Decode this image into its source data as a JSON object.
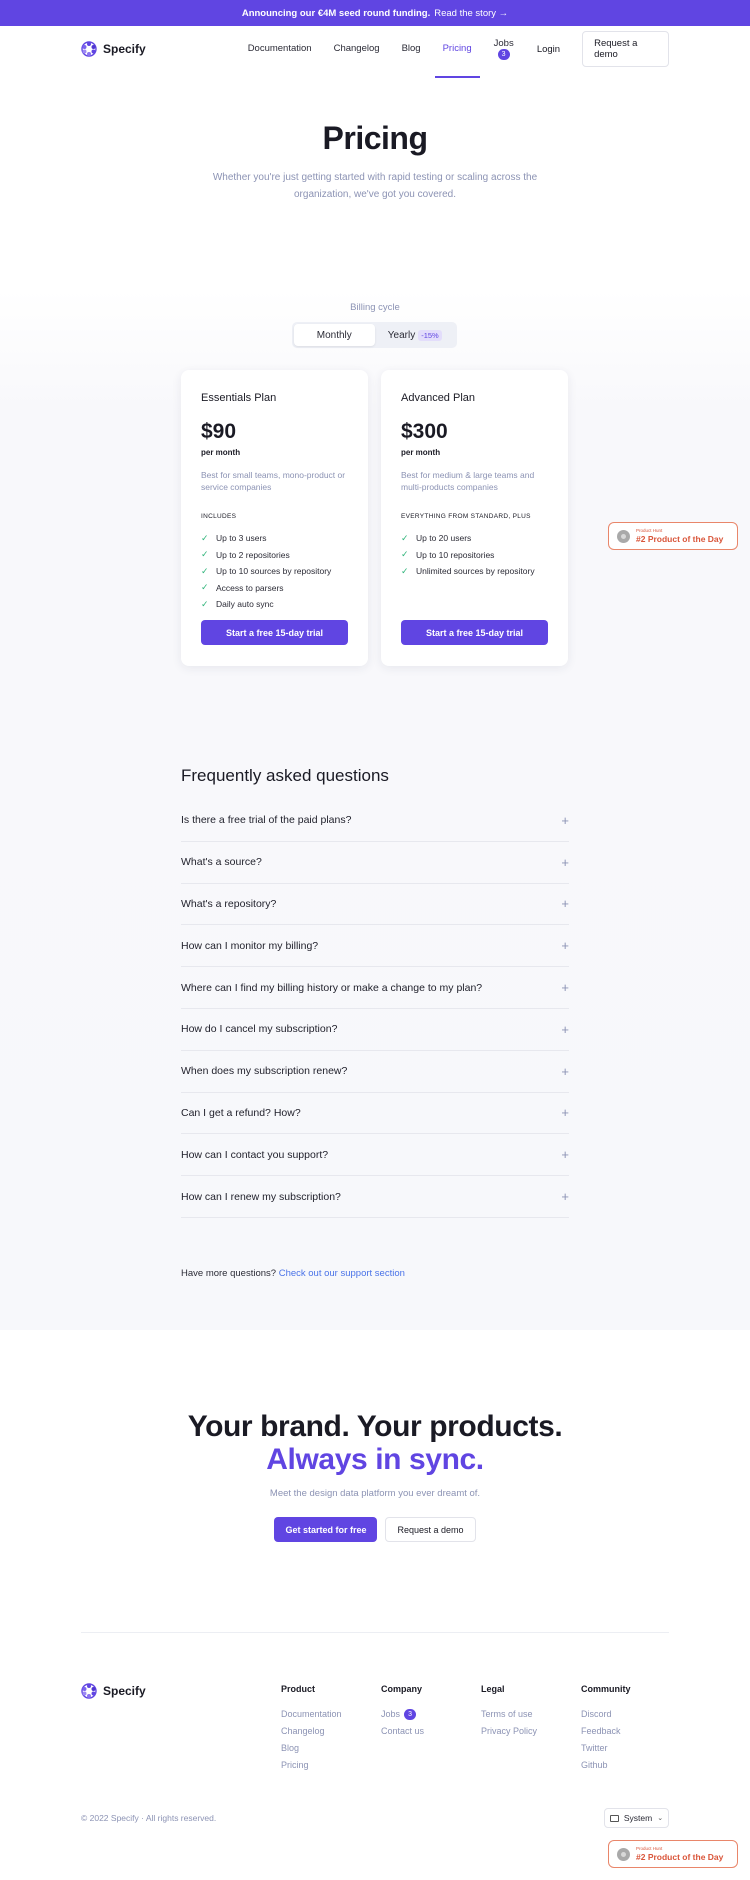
{
  "banner": {
    "bold": "Announcing our €4M seed round funding.",
    "link": "Read the story →"
  },
  "nav": {
    "brand": "Specify",
    "links": [
      {
        "label": "Documentation"
      },
      {
        "label": "Changelog"
      },
      {
        "label": "Blog"
      },
      {
        "label": "Pricing"
      },
      {
        "label": "Jobs",
        "badge": "3"
      }
    ],
    "login": "Login",
    "demo": "Request a demo"
  },
  "hero": {
    "title": "Pricing",
    "subtitle": "Whether you're just getting started with rapid testing or scaling across the organization, we've got you covered."
  },
  "billing": {
    "label": "Billing cycle",
    "monthly": "Monthly",
    "yearly": "Yearly",
    "discount": "-15%"
  },
  "plans": [
    {
      "name": "Essentials Plan",
      "price": "$90",
      "period": "per month",
      "description": "Best for small teams, mono-product or service companies",
      "includes_label": "INCLUDES",
      "features": [
        "Up to 3 users",
        "Up to 2 repositories",
        "Up to 10 sources by repository",
        "Access to parsers",
        "Daily auto sync"
      ],
      "cta": "Start a free 15-day trial"
    },
    {
      "name": "Advanced Plan",
      "price": "$300",
      "period": "per month",
      "description": "Best for medium & large teams and multi-products companies",
      "includes_label": "EVERYTHING FROM STANDARD, PLUS",
      "features": [
        "Up to 20 users",
        "Up to 10 repositories",
        "Unlimited sources by repository"
      ],
      "cta": "Start a free 15-day trial"
    }
  ],
  "product_hunt": {
    "small": "Product Hunt",
    "big": "#2 Product of the Day"
  },
  "faq": {
    "title": "Frequently asked questions",
    "items": [
      "Is there a free trial of the paid plans?",
      "What's a source?",
      "What's a repository?",
      "How can I monitor my billing?",
      "Where can I find my billing history or make a change to my plan?",
      "How do I cancel my subscription?",
      "When does my subscription renew?",
      "Can I get a refund? How?",
      "How can I contact you support?",
      "How can I renew my subscription?"
    ],
    "more_text": "Have more questions?",
    "more_link": "Check out our support section"
  },
  "cta": {
    "line1": "Your brand. Your products.",
    "line2": "Always in sync.",
    "subtitle": "Meet the design data platform you ever dreamt of.",
    "primary": "Get started for free",
    "secondary": "Request a demo"
  },
  "footer": {
    "brand": "Specify",
    "columns": [
      {
        "title": "Product",
        "links": [
          "Documentation",
          "Changelog",
          "Blog",
          "Pricing"
        ]
      },
      {
        "title": "Company",
        "links": [
          "Jobs",
          "Contact us"
        ],
        "badge": "3"
      },
      {
        "title": "Legal",
        "links": [
          "Terms of use",
          "Privacy Policy"
        ]
      },
      {
        "title": "Community",
        "links": [
          "Discord",
          "Feedback",
          "Twitter",
          "Github"
        ]
      }
    ],
    "copyright": "© 2022 Specify · All rights reserved.",
    "theme": "System"
  },
  "colors": {
    "accent": "#6045e2",
    "muted": "#8c93b4",
    "link": "#4a73e8",
    "badge_border": "#e9866a",
    "check": "#2fb47a"
  },
  "icons": [
    "specify-logo-icon",
    "check-icon",
    "plus-icon",
    "medal-icon",
    "monitor-icon",
    "chevron-down-icon"
  ]
}
